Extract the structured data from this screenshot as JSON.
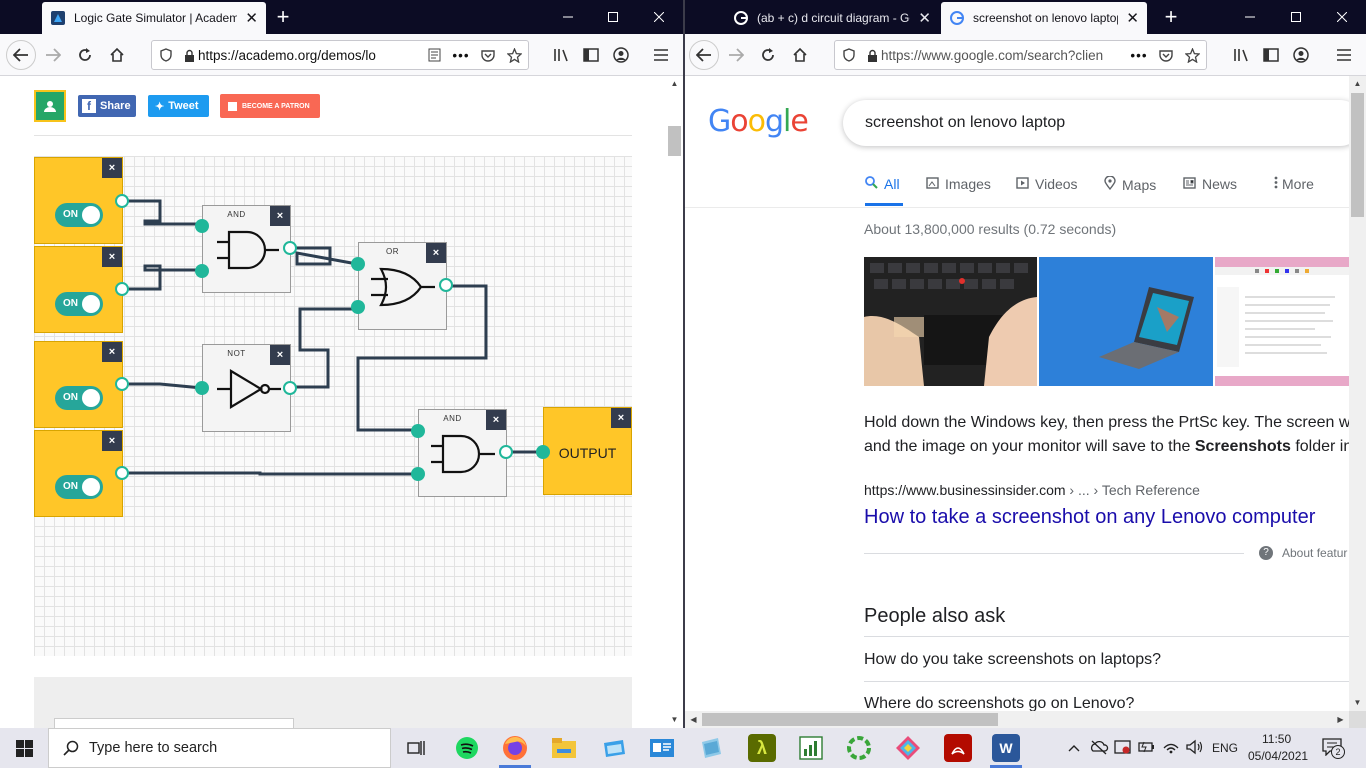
{
  "left_window": {
    "tab": {
      "title": "Logic Gate Simulator | Academo",
      "close": "✕"
    },
    "new_tab": "+",
    "url": "https://academo.org/demos/lo",
    "url_more": "•••",
    "page": {
      "share": "Share",
      "tweet": "Tweet",
      "patron": "BECOME A PATRON",
      "inputs": [
        {
          "label": "ON"
        },
        {
          "label": "ON"
        },
        {
          "label": "ON"
        },
        {
          "label": "ON"
        }
      ],
      "gates": {
        "and1": "AND",
        "or1": "OR",
        "not1": "NOT",
        "and2": "AND"
      },
      "output": "OUTPUT",
      "close": "×"
    }
  },
  "right_window": {
    "tabs": [
      {
        "title": "(ab + c) d circuit diagram - Go",
        "close": "✕"
      },
      {
        "title": "screenshot on lenovo laptop",
        "close": "✕"
      }
    ],
    "new_tab": "+",
    "url": "https://www.google.com/search?clien",
    "url_more": "•••",
    "google": {
      "logo_letters": [
        "G",
        "o",
        "o",
        "g",
        "l",
        "e"
      ],
      "logo_colors": [
        "#4285f4",
        "#ea4335",
        "#fbbc05",
        "#4285f4",
        "#34a853",
        "#ea4335"
      ],
      "query": "screenshot on lenovo laptop",
      "tabs": [
        {
          "label": "All",
          "icon": "search-icon"
        },
        {
          "label": "Images",
          "icon": "image-icon"
        },
        {
          "label": "Videos",
          "icon": "video-icon"
        },
        {
          "label": "Maps",
          "icon": "pin-icon"
        },
        {
          "label": "News",
          "icon": "news-icon"
        },
        {
          "label": "More",
          "icon": "dots-icon"
        }
      ],
      "result_stats": "About 13,800,000 results (0.72 seconds)",
      "snippet_line1": "Hold down the Windows key, then press the PrtSc key. The screen w",
      "snippet_line2_a": "and the image on your monitor will save to the ",
      "snippet_line2_b": "Screenshots",
      "snippet_line2_c": " folder in",
      "source_url": "https://www.businessinsider.com",
      "breadcrumb": " › ... › Tech Reference",
      "result_title": "How to take a screenshot on any Lenovo computer",
      "about_featured": "About featur",
      "paa_heading": "People also ask",
      "paa_items": [
        "How do you take screenshots on laptops?",
        "Where do screenshots go on Lenovo?"
      ]
    }
  },
  "taskbar": {
    "search_placeholder": "Type here to search",
    "lang": "ENG",
    "time": "11:50",
    "date": "05/04/2021",
    "notifications": "2"
  }
}
